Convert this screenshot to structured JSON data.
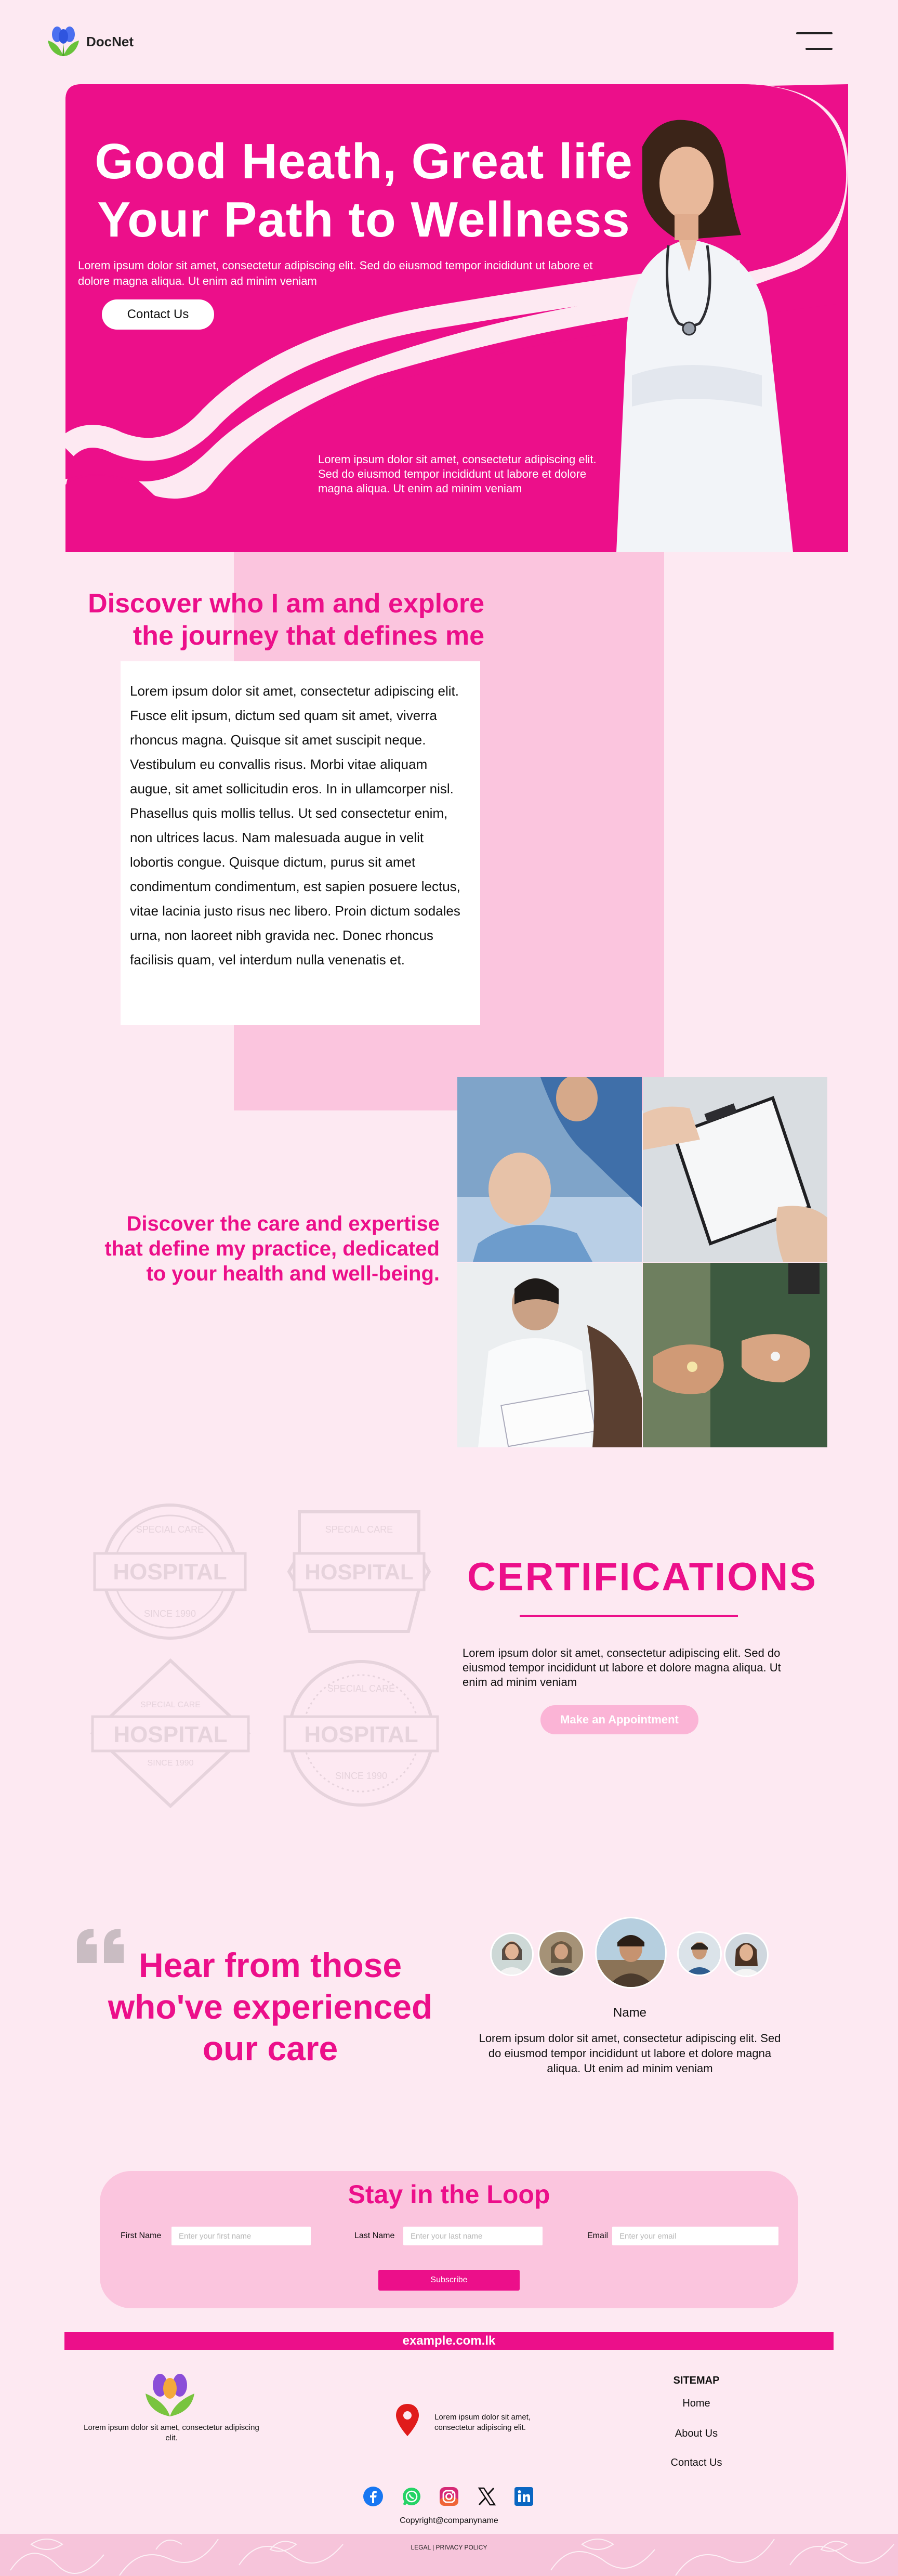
{
  "brand": {
    "name": "DocNet"
  },
  "hero": {
    "title_line1": "Good Heath, Great life",
    "title_line2": "Your Path to Wellness",
    "description": "Lorem ipsum dolor sit amet, consectetur adipiscing elit. Sed do eiusmod tempor incididunt ut labore et dolore magna aliqua. Ut enim ad minim veniam",
    "cta_label": "Contact Us",
    "description2": "Lorem ipsum dolor sit amet, consectetur adipiscing elit. Sed do eiusmod tempor incididunt ut labore et dolore magna aliqua. Ut enim ad minim veniam"
  },
  "about": {
    "title_line1": "Discover who I am and explore",
    "title_line2": "the journey that defines me",
    "body": "Lorem ipsum dolor sit amet, consectetur adipiscing elit. Fusce elit ipsum, dictum sed quam sit amet, viverra rhoncus magna. Quisque sit amet suscipit neque. Vestibulum eu convallis risus. Morbi vitae aliquam augue, sit amet sollicitudin eros. In in ullamcorper nisl. Phasellus quis mollis tellus. Ut sed consectetur enim, non ultrices lacus. Nam malesuada augue in velit lobortis congue. Quisque dictum, purus sit amet condimentum condimentum, est sapien posuere lectus, vitae lacinia justo risus nec libero. Proin dictum sodales urna, non laoreet nibh gravida nec. Donec rhoncus facilisis quam, vel interdum nulla venenatis et."
  },
  "services": {
    "text": "Discover the care and expertise that define my practice, dedicated to your health and well-being."
  },
  "certifications": {
    "badge_word": "HOSPITAL",
    "badge_top": "SPECIAL CARE",
    "badge_bottom": "SINCE 1990",
    "title": "CERTIFICATIONS",
    "description": "Lorem ipsum dolor sit amet, consectetur adipiscing elit. Sed do eiusmod tempor incididunt ut labore et dolore magna aliqua. Ut enim ad minim veniam",
    "cta_label": "Make an Appointment"
  },
  "testimonials": {
    "title": "Hear from those who've experienced our care",
    "name": "Name",
    "text": "Lorem ipsum dolor sit amet, consectetur adipiscing elit. Sed do eiusmod tempor incididunt ut labore et dolore magna aliqua. Ut enim ad minim veniam"
  },
  "newsletter": {
    "title": "Stay in the Loop",
    "first_name_label": "First Name",
    "first_name_placeholder": "Enter your first name",
    "last_name_label": "Last Name",
    "last_name_placeholder": "Enter your last name",
    "email_label": "Email",
    "email_placeholder": "Enter your email",
    "submit_label": "Subscribe"
  },
  "footer": {
    "domain": "example.com.lk",
    "description": "Lorem ipsum dolor sit amet, consectetur adipiscing elit.",
    "address": "Lorem ipsum dolor sit amet, consectetur adipiscing elit.",
    "sitemap_title": "SITEMAP",
    "sitemap_links": [
      "Home",
      "About Us",
      "Contact Us"
    ],
    "social_icons": [
      "facebook-icon",
      "whatsapp-icon",
      "instagram-icon",
      "x-icon",
      "linkedin-icon"
    ],
    "copyright": "Copyright@companyname",
    "legal": "LEGAL | PRIVACY POLICY"
  },
  "colors": {
    "accent": "#ec0f8a",
    "page_bg": "#fde9f2",
    "panel_pink": "#fbc5de",
    "button_light": "#fbb4d6"
  }
}
